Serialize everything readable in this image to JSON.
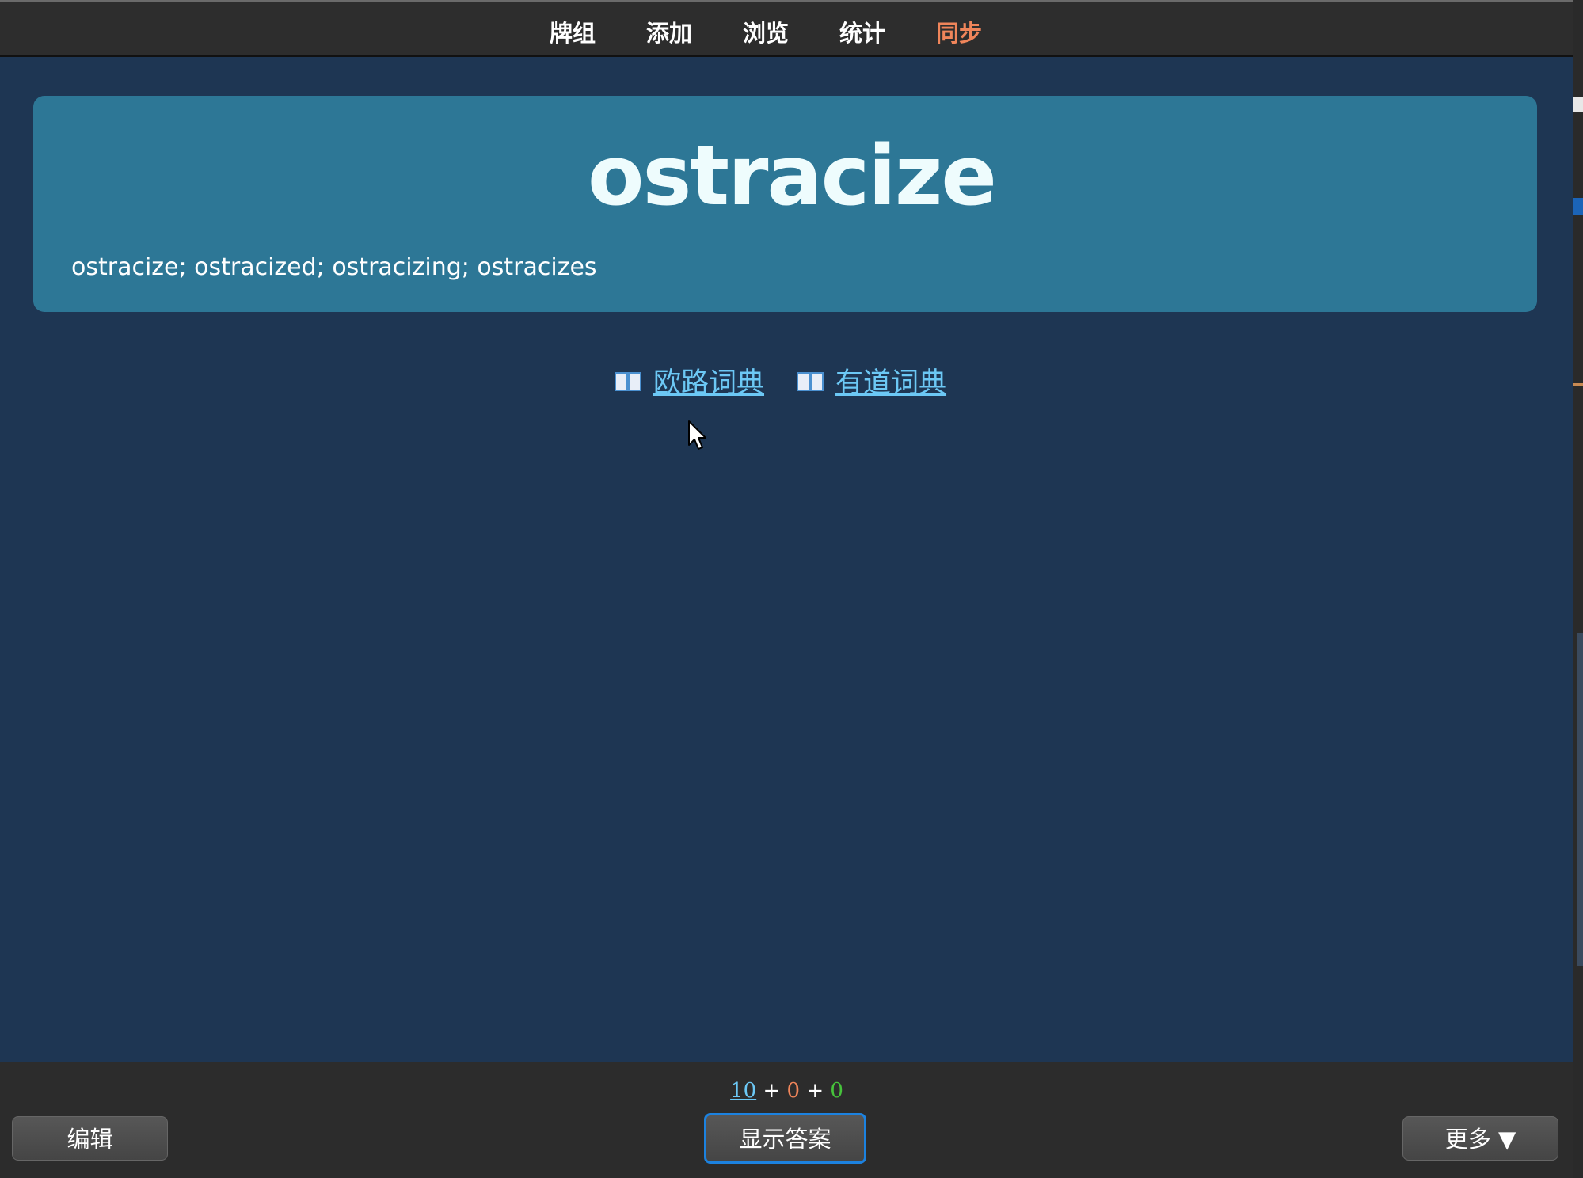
{
  "nav": {
    "items": [
      {
        "label": "牌组",
        "active": false
      },
      {
        "label": "添加",
        "active": false
      },
      {
        "label": "浏览",
        "active": false
      },
      {
        "label": "统计",
        "active": false
      },
      {
        "label": "同步",
        "active": true
      }
    ],
    "active_color": "#f0855a"
  },
  "card": {
    "word": "ostracize",
    "forms": "ostracize; ostracized; ostracizing; ostracizes",
    "background_color": "#2d7796"
  },
  "dictionaries": [
    {
      "label": "欧路词典",
      "icon": "book-icon"
    },
    {
      "label": "有道词典",
      "icon": "book-icon"
    }
  ],
  "counts": {
    "new": "10",
    "learning": "0",
    "review": "0",
    "separator": "+",
    "colors": {
      "new": "#6cc8f5",
      "learning": "#f0855a",
      "review": "#46c33b"
    }
  },
  "buttons": {
    "edit": "编辑",
    "show_answer": "显示答案",
    "more": "更多 ▼"
  },
  "colors": {
    "background": "#1e3653",
    "bars": "#2c2c2c",
    "link": "#6cc8f5"
  }
}
